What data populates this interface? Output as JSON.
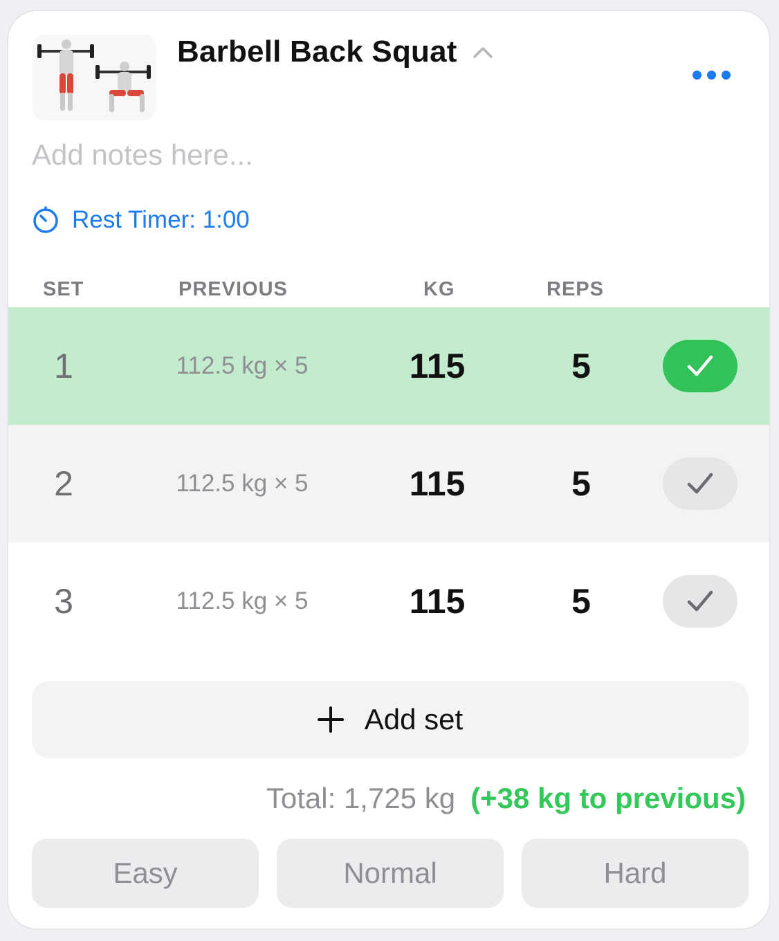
{
  "exercise": {
    "title": "Barbell Back Squat",
    "notes_placeholder": "Add notes here...",
    "rest_timer": "Rest Timer: 1:00"
  },
  "table": {
    "headers": [
      "SET",
      "PREVIOUS",
      "KG",
      "REPS"
    ],
    "rows": [
      {
        "set": "1",
        "previous": "112.5 kg × 5",
        "kg": "115",
        "reps": "5",
        "completed": true
      },
      {
        "set": "2",
        "previous": "112.5 kg × 5",
        "kg": "115",
        "reps": "5",
        "completed": false
      },
      {
        "set": "3",
        "previous": "112.5 kg × 5",
        "kg": "115",
        "reps": "5",
        "completed": false
      }
    ]
  },
  "add_set_label": "Add set",
  "summary": {
    "total": "Total: 1,725 kg",
    "delta": "(+38 kg to previous)"
  },
  "difficulty": [
    "Easy",
    "Normal",
    "Hard"
  ],
  "colors": {
    "accent": "#1a7cf0",
    "done_row": "#c3ecce",
    "check_on": "#33c15a",
    "positive": "#34c759"
  },
  "icons": {
    "more": "ellipsis-icon",
    "chevron": "chevron-up-icon",
    "timer": "stopwatch-icon",
    "check": "checkmark-icon",
    "add": "plus-icon",
    "thumbnail": "exercise-illustration"
  }
}
